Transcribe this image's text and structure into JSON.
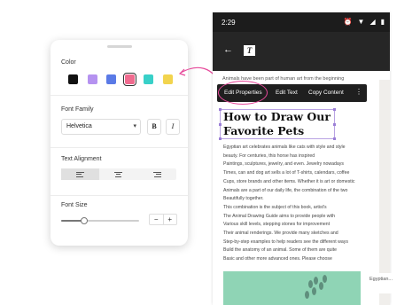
{
  "panel": {
    "color_label": "Color",
    "swatches": [
      "#111111",
      "#b592f0",
      "#5a7ae6",
      "#f06b8f",
      "#38d0c8",
      "#f2d44e"
    ],
    "selected_swatch": "#f06b8f",
    "font_family_label": "Font Family",
    "font_value": "Helvetica",
    "bold_label": "B",
    "italic_label": "I",
    "text_alignment_label": "Text Alignment",
    "alignment_selected": "left",
    "font_size_label": "Font Size",
    "font_size_level": 0.3,
    "minus_label": "−",
    "plus_label": "+"
  },
  "status_bar": {
    "time": "2:29"
  },
  "accent": "#e6489a",
  "context_menu": {
    "edit_properties": "Edit Properties",
    "edit_text": "Edit Text",
    "copy_content": "Copy Content"
  },
  "article": {
    "intro": "Animals have been part of human art from the beginning",
    "headline_line1": "How to Draw Our",
    "headline_line2": "Favorite Pets",
    "body": [
      "Egyptian art celebrates animals like cats with style and style",
      "beauty. For centuries, this horse has inspired",
      "Paintings, sculptures, jewelry, and even. Jewelry nowadays",
      "Times, can and dog art sells a lot of T-shirts, calendars, coffee",
      "Cups, store brands and other items. Whether it is art or domestic",
      "Animals are a part of our daily life, the combination of the two",
      "Beautifully together.",
      "This combination is the subject of this book, artist's",
      "The Animal Drawing Guide aims to provide people with",
      "Various skill levels, stepping stones for improvement",
      "Their animal renderings. We provide many sketches and",
      "Step-by-step examples to help readers see the different ways",
      "Build the anatomy of an animal. Some of them are quite",
      "Basic and other more advanced ones. Please choose"
    ],
    "side_caption": "Egyptian..."
  }
}
